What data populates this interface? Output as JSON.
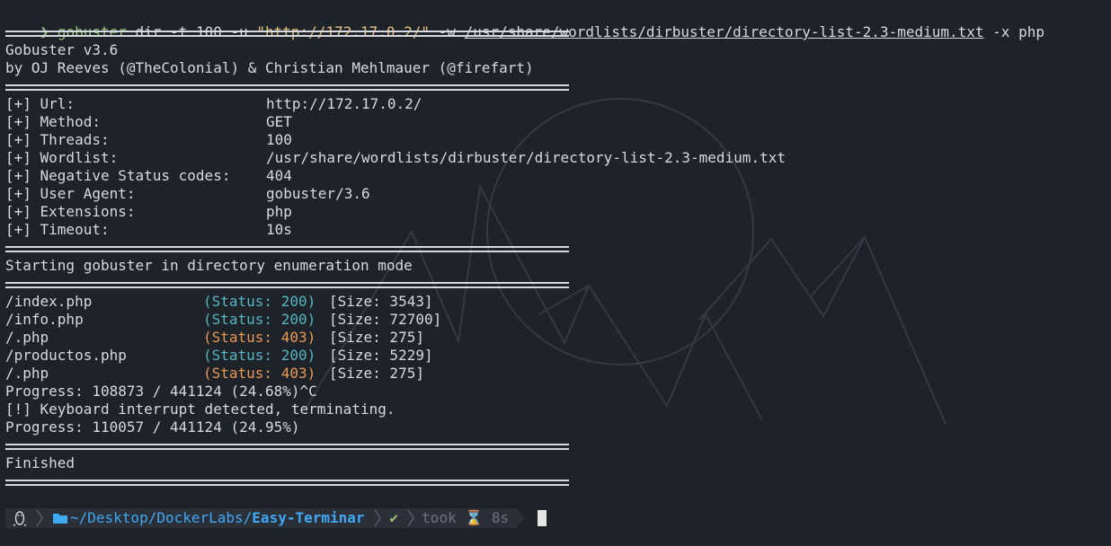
{
  "command": {
    "prompt_symbol": "❯",
    "program": "gobuster",
    "args_before_url": " dir -t 100 -u ",
    "url": "\"http://172.17.0.2/\"",
    "wordlist_flag": " -w ",
    "wordlist_path": "/usr/share/wordlists/dirbuster/directory-list-2.3-medium.txt",
    "args_after": " -x php"
  },
  "banner": {
    "title": "Gobuster v3.6",
    "authors": "by OJ Reeves (@TheColonial) & Christian Mehlmauer (@firefart)"
  },
  "config": [
    {
      "label": "[+] Url:",
      "value": "http://172.17.0.2/"
    },
    {
      "label": "[+] Method:",
      "value": "GET"
    },
    {
      "label": "[+] Threads:",
      "value": "100"
    },
    {
      "label": "[+] Wordlist:",
      "value": "/usr/share/wordlists/dirbuster/directory-list-2.3-medium.txt"
    },
    {
      "label": "[+] Negative Status codes:",
      "value": "404"
    },
    {
      "label": "[+] User Agent:",
      "value": "gobuster/3.6"
    },
    {
      "label": "[+] Extensions:",
      "value": "php"
    },
    {
      "label": "[+] Timeout:",
      "value": "10s"
    }
  ],
  "mode_message": "Starting gobuster in directory enumeration mode",
  "results": [
    {
      "path": "/index.php",
      "status": "(Status: 200)",
      "size": "[Size: 3543]",
      "status_color": "teal"
    },
    {
      "path": "/info.php",
      "status": "(Status: 200)",
      "size": "[Size: 72700]",
      "status_color": "teal"
    },
    {
      "path": "/.php",
      "status": "(Status: 403)",
      "size": "[Size: 275]",
      "status_color": "orange"
    },
    {
      "path": "/productos.php",
      "status": "(Status: 200)",
      "size": "[Size: 5229]",
      "status_color": "teal"
    },
    {
      "path": "/.php",
      "status": "(Status: 403)",
      "size": "[Size: 275]",
      "status_color": "orange"
    }
  ],
  "progress_1": "Progress: 108873 / 441124 (24.68%)^C",
  "interrupt": "[!] Keyboard interrupt detected, terminating.",
  "progress_2": "Progress: 110057 / 441124 (24.95%)",
  "finished": "Finished",
  "prompt_bar": {
    "os_icon": "linux-icon",
    "folder_icon": "folder-icon",
    "path_prefix": "~/Desktop/DockerLabs/",
    "path_current": "Easy-Terminar",
    "check": "✔",
    "took_label": "took",
    "hourglass": "⌛",
    "duration": "8s"
  },
  "colors": {
    "background": "#1e2229",
    "text": "#d7dae0",
    "command_green": "#98c379",
    "string_yellow": "#e5c07b",
    "status_200": "#56b6c2",
    "status_403": "#e89a55",
    "path_blue": "#3fa9f5"
  }
}
